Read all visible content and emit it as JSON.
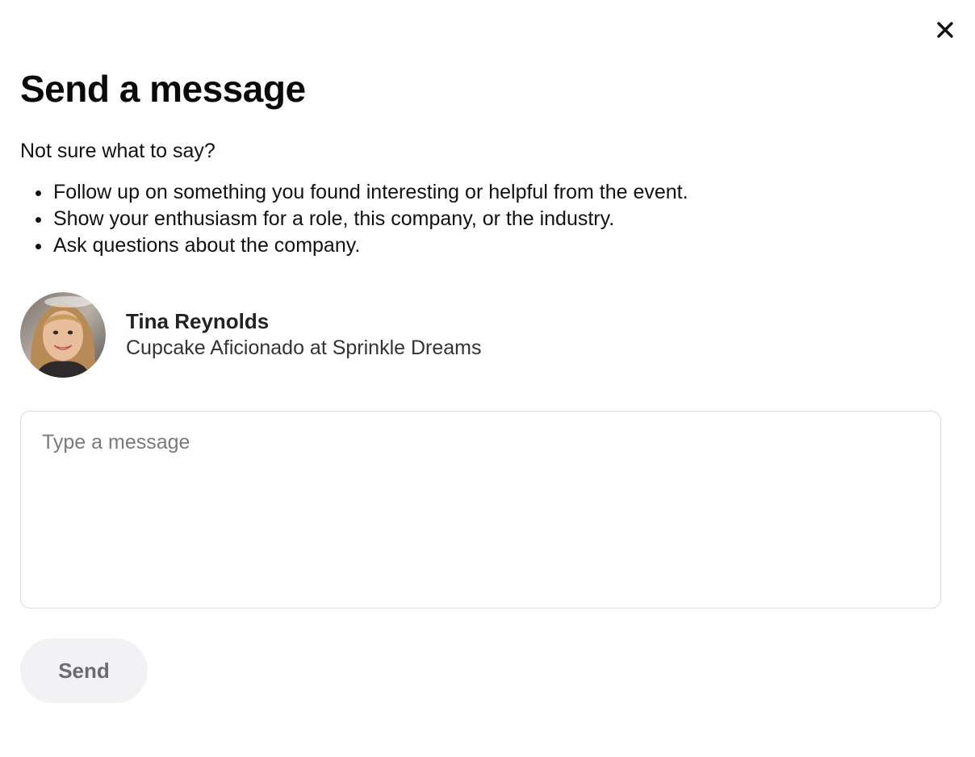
{
  "dialog": {
    "title": "Send a message",
    "subtitle": "Not sure what to say?",
    "tips": [
      "Follow up on something you found interesting or helpful from the event.",
      "Show your enthusiasm for a role, this company, or the industry.",
      "Ask questions about the company."
    ],
    "close_icon": "close-icon"
  },
  "recipient": {
    "name": "Tina Reynolds",
    "role": "Cupcake Aficionado at Sprinkle Dreams",
    "avatar_icon": "avatar-photo"
  },
  "message": {
    "placeholder": "Type a message",
    "value": ""
  },
  "actions": {
    "send_label": "Send"
  },
  "colors": {
    "text": "#111111",
    "placeholder": "#7a7a7a",
    "border": "#dcdcdc",
    "send_bg": "#f2f2f4",
    "send_text": "#6b6b70"
  }
}
